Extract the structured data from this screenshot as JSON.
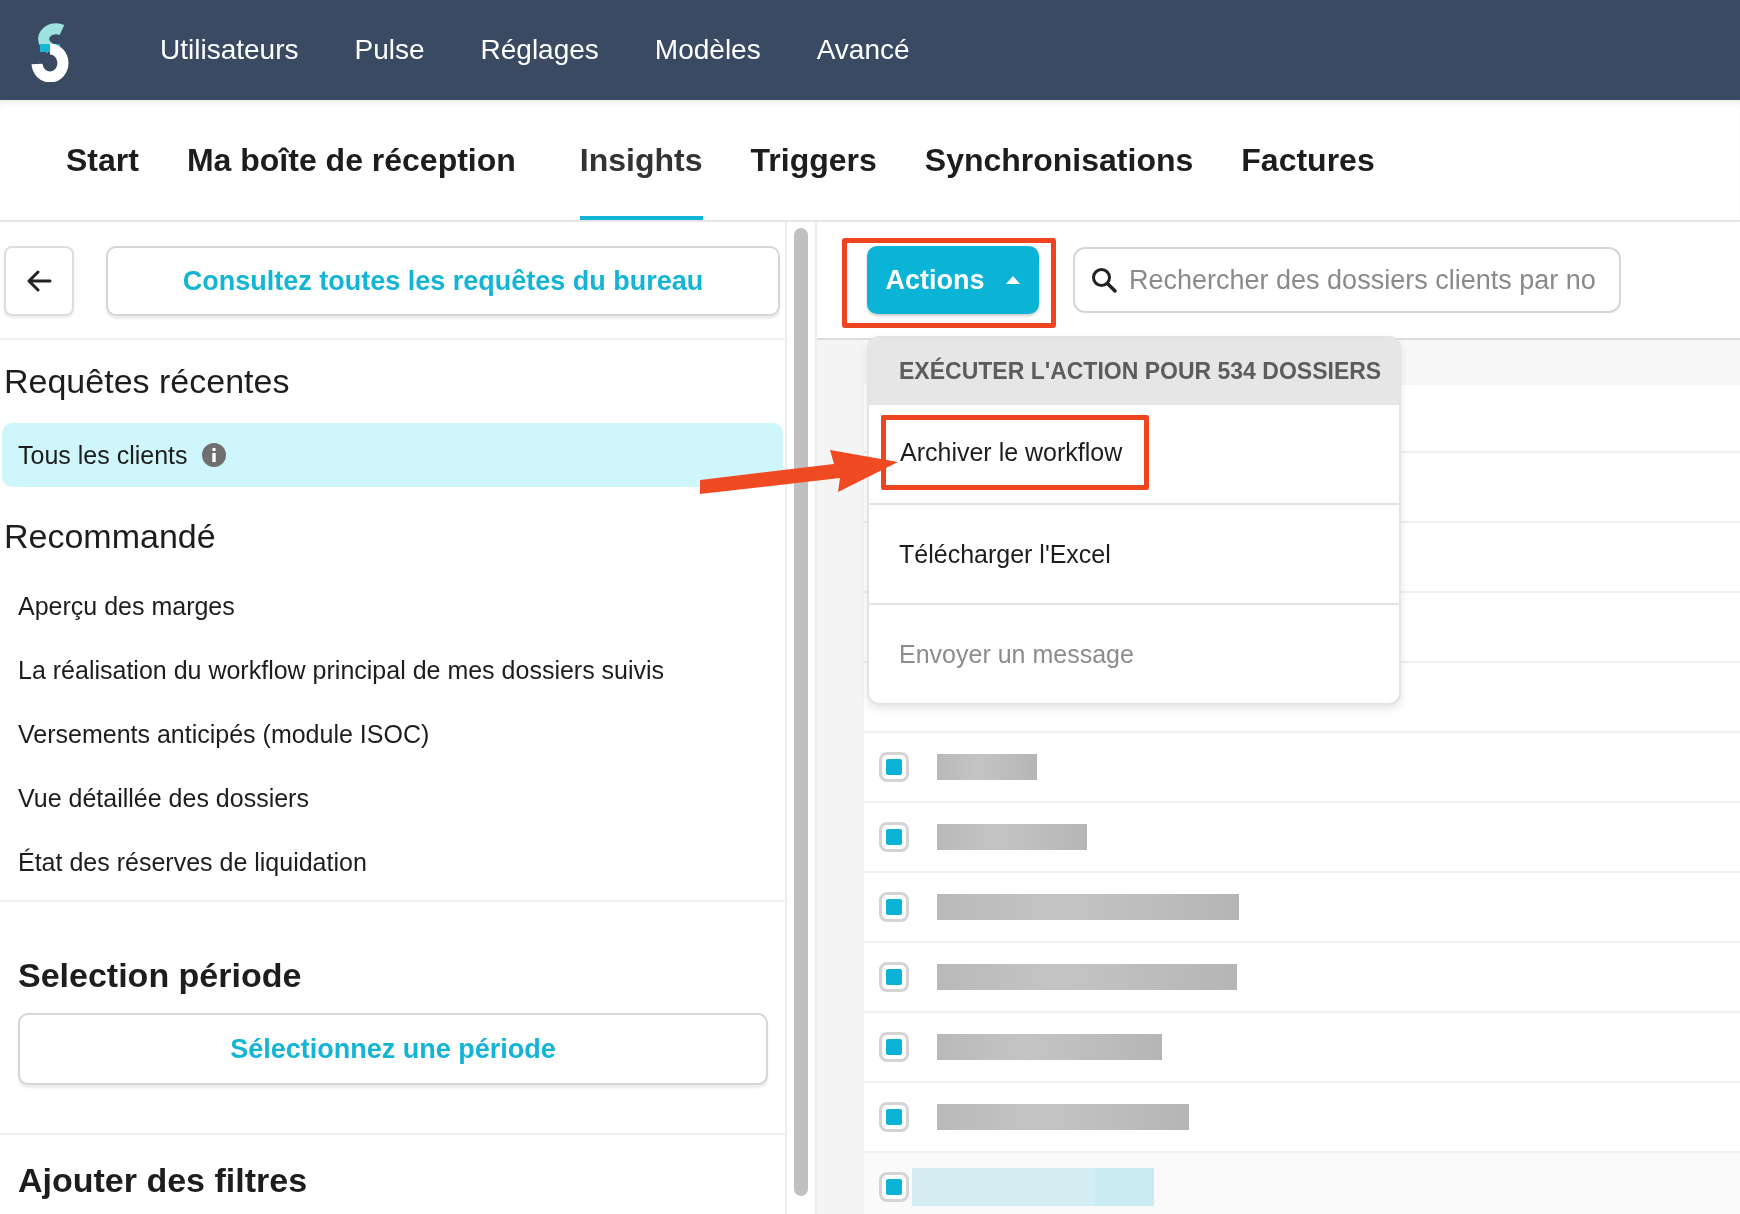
{
  "top_nav": {
    "items": [
      "Utilisateurs",
      "Pulse",
      "Réglages",
      "Modèles",
      "Avancé"
    ]
  },
  "tabs": [
    {
      "label": "Start",
      "selected": false
    },
    {
      "label": "Ma boîte de réception",
      "selected": false
    },
    {
      "label": "Insights",
      "selected": true
    },
    {
      "label": "Triggers",
      "selected": false
    },
    {
      "label": "Synchronisations",
      "selected": false
    },
    {
      "label": "Factures",
      "selected": false
    }
  ],
  "sidebar": {
    "all_queries_button": "Consultez toutes les requêtes du bureau",
    "recent_title": "Requêtes récentes",
    "recent_items": [
      {
        "label": "Tous les clients",
        "selected": true
      }
    ],
    "recommended_title": "Recommandé",
    "recommended_items": [
      "Aperçu des marges",
      "La réalisation du workflow principal de mes dossiers suivis",
      "Versements anticipés (module ISOC)",
      "Vue détaillée des dossiers",
      "État des réserves de liquidation"
    ],
    "period_title": "Selection période",
    "period_button": "Sélectionnez une période",
    "filters_title": "Ajouter des filtres"
  },
  "toolbar": {
    "actions_button": "Actions",
    "expanded": true,
    "search": {
      "placeholder": "Rechercher des dossiers clients par no"
    }
  },
  "actions_menu": {
    "header": "EXÉCUTER L'ACTION POUR 534 DOSSIERS",
    "items": [
      {
        "label": "Archiver le workflow",
        "disabled": false,
        "highlighted": true
      },
      {
        "label": "Télécharger l'Excel",
        "disabled": false,
        "highlighted": false
      },
      {
        "label": "Envoyer un message",
        "disabled": true,
        "highlighted": false
      }
    ]
  },
  "table": {
    "rows": [
      {
        "checked": true,
        "selected": false
      },
      {
        "checked": true,
        "selected": false
      },
      {
        "checked": true,
        "selected": false
      },
      {
        "checked": true,
        "selected": false
      },
      {
        "checked": true,
        "selected": false
      },
      {
        "checked": true,
        "selected": false
      },
      {
        "checked": true,
        "selected": true
      }
    ]
  }
}
